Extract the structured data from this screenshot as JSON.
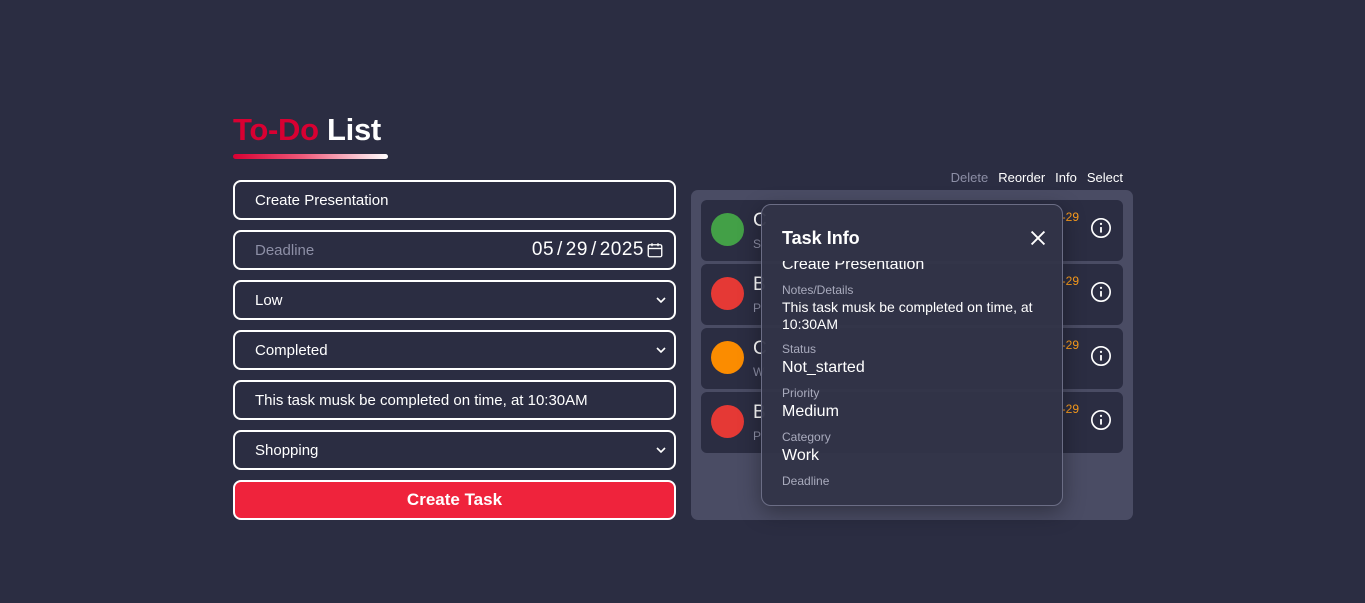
{
  "header": {
    "title_part1": "To-Do",
    "title_part2": "List"
  },
  "form": {
    "task_name": "Create Presentation",
    "deadline_placeholder": "Deadline",
    "deadline_month": "05",
    "deadline_day": "29",
    "deadline_year": "2025",
    "priority": "Low",
    "status": "Completed",
    "notes": "This task musk be completed on time, at 10:30AM",
    "category": "Shopping",
    "submit_label": "Create Task"
  },
  "toolbar": {
    "delete": "Delete",
    "reorder": "Reorder",
    "info": "Info",
    "select": "Select"
  },
  "tasks": [
    {
      "name": "C",
      "sub": "S",
      "date": "-29",
      "color": "#43a047"
    },
    {
      "name": "B",
      "sub": "P",
      "date": "-29",
      "color": "#e53935"
    },
    {
      "name": "C",
      "sub": "W",
      "date": "-29",
      "color": "#fb8c00"
    },
    {
      "name": "B",
      "sub": "P",
      "date": "-29",
      "color": "#e53935"
    }
  ],
  "modal": {
    "title": "Task Info",
    "task_name": "Create Presentation",
    "notes_label": "Notes/Details",
    "notes": "This task musk be completed on time, at 10:30AM",
    "status_label": "Status",
    "status": "Not_started",
    "priority_label": "Priority",
    "priority": "Medium",
    "category_label": "Category",
    "category": "Work",
    "deadline_label": "Deadline"
  },
  "colors": {
    "background": "#2b2d42",
    "accent": "#ef233c",
    "title_red": "#d80032",
    "panel": "#4a4c64",
    "date_orange": "#ff9f1c"
  }
}
